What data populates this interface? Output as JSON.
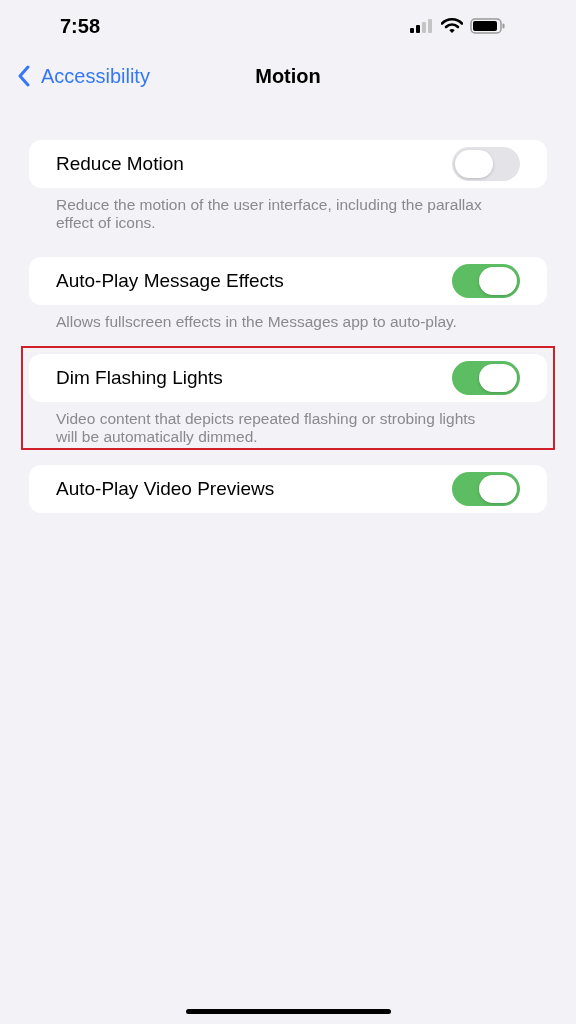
{
  "status_bar": {
    "time": "7:58"
  },
  "nav": {
    "back": "Accessibility",
    "title": "Motion"
  },
  "settings": [
    {
      "label": "Reduce Motion",
      "on": false,
      "footer": "Reduce the motion of the user interface, including the parallax effect of icons.",
      "highlighted": false
    },
    {
      "label": "Auto-Play Message Effects",
      "on": true,
      "footer": "Allows fullscreen effects in the Messages app to auto-play.",
      "highlighted": false
    },
    {
      "label": "Dim Flashing Lights",
      "on": true,
      "footer": "Video content that depicts repeated flashing or strobing lights will be automatically dimmed.",
      "highlighted": true
    },
    {
      "label": "Auto-Play Video Previews",
      "on": true,
      "highlighted": false
    }
  ]
}
